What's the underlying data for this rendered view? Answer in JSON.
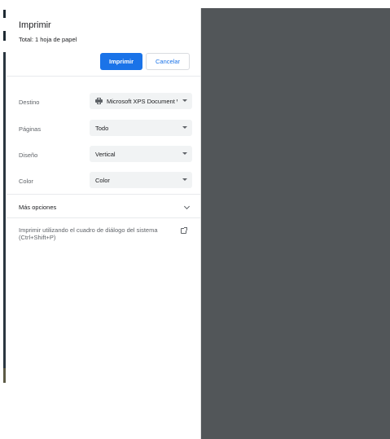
{
  "header": {
    "title": "Imprimir",
    "summary": "Total: 1 hoja de papel"
  },
  "actions": {
    "print_label": "Imprimir",
    "cancel_label": "Cancelar"
  },
  "settings": [
    {
      "label": "Destino",
      "value": "Microsoft XPS Document Writer",
      "icon": "printer-icon"
    },
    {
      "label": "Páginas",
      "value": "Todo"
    },
    {
      "label": "Diseño",
      "value": "Vertical"
    },
    {
      "label": "Color",
      "value": "Color"
    }
  ],
  "more_options": {
    "label": "Más opciones",
    "icon": "chevron-down-icon"
  },
  "system_dialog": {
    "label": "Imprimir utilizando el cuadro de diálogo del sistema (Ctrl+Shift+P)",
    "icon": "open-in-new-icon"
  },
  "colors": {
    "accent": "#1a73e8",
    "preview_background": "#525659",
    "select_background": "#f1f3f4"
  }
}
